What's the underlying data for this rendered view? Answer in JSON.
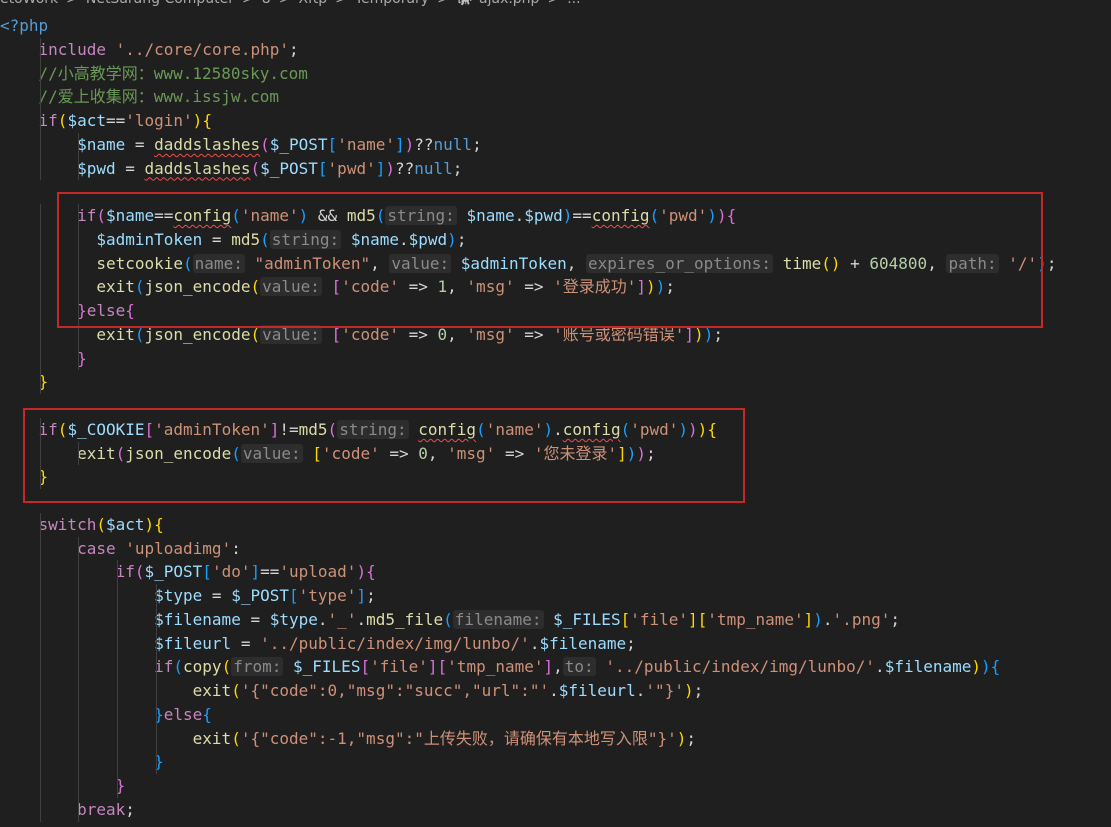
{
  "breadcrumb": {
    "items": [
      "etoWork",
      "NetSarang Computer",
      "8",
      "Xftp",
      "Temporary",
      "ajax.php",
      "..."
    ],
    "separator": ">",
    "file_icon": "php-elephant-icon"
  },
  "editor": {
    "language": "php",
    "lines": [
      [
        {
          "t": "<?php",
          "c": "const"
        }
      ],
      [
        {
          "t": "    "
        },
        {
          "t": "include",
          "c": "keyword"
        },
        {
          "t": " "
        },
        {
          "t": "'../core/core.php'",
          "c": "string"
        },
        {
          "t": ";"
        }
      ],
      [
        {
          "t": "    "
        },
        {
          "t": "//小高教学网：www.12580sky.com",
          "c": "comment"
        }
      ],
      [
        {
          "t": "    "
        },
        {
          "t": "//爱上收集网：www.issjw.com",
          "c": "comment"
        }
      ],
      [
        {
          "t": "    "
        },
        {
          "t": "if",
          "c": "keyword"
        },
        {
          "t": "(",
          "c": "bracket1"
        },
        {
          "t": "$act",
          "c": "var"
        },
        {
          "t": "=="
        },
        {
          "t": "'login'",
          "c": "string"
        },
        {
          "t": ")",
          "c": "bracket1"
        },
        {
          "t": "{",
          "c": "bracket1"
        }
      ],
      [
        {
          "t": "        "
        },
        {
          "t": "$name",
          "c": "var"
        },
        {
          "t": " = "
        },
        {
          "t": "daddslashes",
          "c": "func",
          "sq": true
        },
        {
          "t": "(",
          "c": "bracket2"
        },
        {
          "t": "$_POST",
          "c": "var"
        },
        {
          "t": "[",
          "c": "bracket3"
        },
        {
          "t": "'name'",
          "c": "string"
        },
        {
          "t": "]",
          "c": "bracket3"
        },
        {
          "t": ")",
          "c": "bracket2"
        },
        {
          "t": "??"
        },
        {
          "t": "null",
          "c": "const"
        },
        {
          "t": ";"
        }
      ],
      [
        {
          "t": "        "
        },
        {
          "t": "$pwd",
          "c": "var"
        },
        {
          "t": " = "
        },
        {
          "t": "daddslashes",
          "c": "func",
          "sq": true
        },
        {
          "t": "(",
          "c": "bracket2"
        },
        {
          "t": "$_POST",
          "c": "var"
        },
        {
          "t": "[",
          "c": "bracket3"
        },
        {
          "t": "'pwd'",
          "c": "string"
        },
        {
          "t": "]",
          "c": "bracket3"
        },
        {
          "t": ")",
          "c": "bracket2"
        },
        {
          "t": "??"
        },
        {
          "t": "null",
          "c": "const"
        },
        {
          "t": ";"
        }
      ],
      [],
      [
        {
          "t": "        "
        },
        {
          "t": "if",
          "c": "keyword"
        },
        {
          "t": "(",
          "c": "bracket2"
        },
        {
          "t": "$name",
          "c": "var"
        },
        {
          "t": "=="
        },
        {
          "t": "config",
          "c": "func",
          "sq": true
        },
        {
          "t": "(",
          "c": "bracket3"
        },
        {
          "t": "'name'",
          "c": "string"
        },
        {
          "t": ")",
          "c": "bracket3"
        },
        {
          "t": " && "
        },
        {
          "t": "md5",
          "c": "func"
        },
        {
          "t": "(",
          "c": "bracket3"
        },
        {
          "t": "string:",
          "c": "hint"
        },
        {
          "t": " "
        },
        {
          "t": "$name",
          "c": "var"
        },
        {
          "t": "."
        },
        {
          "t": "$pwd",
          "c": "var"
        },
        {
          "t": ")",
          "c": "bracket3"
        },
        {
          "t": "=="
        },
        {
          "t": "config",
          "c": "func",
          "sq": true
        },
        {
          "t": "(",
          "c": "bracket3"
        },
        {
          "t": "'pwd'",
          "c": "string"
        },
        {
          "t": ")",
          "c": "bracket3"
        },
        {
          "t": ")",
          "c": "bracket2"
        },
        {
          "t": "{",
          "c": "bracket2"
        }
      ],
      [
        {
          "t": "          "
        },
        {
          "t": "$adminToken",
          "c": "var"
        },
        {
          "t": " = "
        },
        {
          "t": "md5",
          "c": "func"
        },
        {
          "t": "(",
          "c": "bracket3"
        },
        {
          "t": "string:",
          "c": "hint"
        },
        {
          "t": " "
        },
        {
          "t": "$name",
          "c": "var"
        },
        {
          "t": "."
        },
        {
          "t": "$pwd",
          "c": "var"
        },
        {
          "t": ")",
          "c": "bracket3"
        },
        {
          "t": ";"
        }
      ],
      [
        {
          "t": "          "
        },
        {
          "t": "setcookie",
          "c": "func"
        },
        {
          "t": "(",
          "c": "bracket3"
        },
        {
          "t": "name:",
          "c": "hint"
        },
        {
          "t": " "
        },
        {
          "t": "\"adminToken\"",
          "c": "string"
        },
        {
          "t": ", "
        },
        {
          "t": "value:",
          "c": "hint"
        },
        {
          "t": " "
        },
        {
          "t": "$adminToken",
          "c": "var"
        },
        {
          "t": ", "
        },
        {
          "t": "expires_or_options:",
          "c": "hint"
        },
        {
          "t": " "
        },
        {
          "t": "time",
          "c": "func"
        },
        {
          "t": "()",
          "c": "bracket1"
        },
        {
          "t": " + "
        },
        {
          "t": "604800",
          "c": "number"
        },
        {
          "t": ", "
        },
        {
          "t": "path:",
          "c": "hint"
        },
        {
          "t": " "
        },
        {
          "t": "'/'",
          "c": "string"
        },
        {
          "t": ")",
          "c": "bracket3"
        },
        {
          "t": ";"
        }
      ],
      [
        {
          "t": "          "
        },
        {
          "t": "exit",
          "c": "func"
        },
        {
          "t": "(",
          "c": "bracket3"
        },
        {
          "t": "json_encode",
          "c": "func"
        },
        {
          "t": "(",
          "c": "bracket1"
        },
        {
          "t": "value:",
          "c": "hint"
        },
        {
          "t": " "
        },
        {
          "t": "[",
          "c": "bracket2"
        },
        {
          "t": "'code'",
          "c": "string"
        },
        {
          "t": " => "
        },
        {
          "t": "1",
          "c": "number"
        },
        {
          "t": ", "
        },
        {
          "t": "'msg'",
          "c": "string"
        },
        {
          "t": " => "
        },
        {
          "t": "'登录成功'",
          "c": "string"
        },
        {
          "t": "]",
          "c": "bracket2"
        },
        {
          "t": ")",
          "c": "bracket1"
        },
        {
          "t": ")",
          "c": "bracket3"
        },
        {
          "t": ";"
        }
      ],
      [
        {
          "t": "        "
        },
        {
          "t": "}",
          "c": "bracket2"
        },
        {
          "t": "else",
          "c": "keyword"
        },
        {
          "t": "{",
          "c": "bracket2"
        }
      ],
      [
        {
          "t": "          "
        },
        {
          "t": "exit",
          "c": "func"
        },
        {
          "t": "(",
          "c": "bracket3"
        },
        {
          "t": "json_encode",
          "c": "func"
        },
        {
          "t": "(",
          "c": "bracket1"
        },
        {
          "t": "value:",
          "c": "hint"
        },
        {
          "t": " "
        },
        {
          "t": "[",
          "c": "bracket2"
        },
        {
          "t": "'code'",
          "c": "string"
        },
        {
          "t": " => "
        },
        {
          "t": "0",
          "c": "number"
        },
        {
          "t": ", "
        },
        {
          "t": "'msg'",
          "c": "string"
        },
        {
          "t": " => "
        },
        {
          "t": "'账号或密码错误'",
          "c": "string"
        },
        {
          "t": "]",
          "c": "bracket2"
        },
        {
          "t": ")",
          "c": "bracket1"
        },
        {
          "t": ")",
          "c": "bracket3"
        },
        {
          "t": ";"
        }
      ],
      [
        {
          "t": "        "
        },
        {
          "t": "}",
          "c": "bracket2"
        }
      ],
      [
        {
          "t": "    "
        },
        {
          "t": "}",
          "c": "bracket1"
        }
      ],
      [],
      [
        {
          "t": "    "
        },
        {
          "t": "if",
          "c": "keyword"
        },
        {
          "t": "(",
          "c": "bracket1"
        },
        {
          "t": "$_COOKIE",
          "c": "var"
        },
        {
          "t": "[",
          "c": "bracket2"
        },
        {
          "t": "'adminToken'",
          "c": "string"
        },
        {
          "t": "]",
          "c": "bracket2"
        },
        {
          "t": "!="
        },
        {
          "t": "md5",
          "c": "func"
        },
        {
          "t": "(",
          "c": "bracket2"
        },
        {
          "t": "string:",
          "c": "hint"
        },
        {
          "t": " "
        },
        {
          "t": "config",
          "c": "func",
          "sq": true
        },
        {
          "t": "(",
          "c": "bracket3"
        },
        {
          "t": "'name'",
          "c": "string"
        },
        {
          "t": ")",
          "c": "bracket3"
        },
        {
          "t": "."
        },
        {
          "t": "config",
          "c": "func",
          "sq": true
        },
        {
          "t": "(",
          "c": "bracket3"
        },
        {
          "t": "'pwd'",
          "c": "string"
        },
        {
          "t": ")",
          "c": "bracket3"
        },
        {
          "t": ")",
          "c": "bracket2"
        },
        {
          "t": ")",
          "c": "bracket1"
        },
        {
          "t": "{",
          "c": "bracket1"
        }
      ],
      [
        {
          "t": "        "
        },
        {
          "t": "exit",
          "c": "func"
        },
        {
          "t": "(",
          "c": "bracket2"
        },
        {
          "t": "json_encode",
          "c": "func"
        },
        {
          "t": "(",
          "c": "bracket3"
        },
        {
          "t": "value:",
          "c": "hint"
        },
        {
          "t": " "
        },
        {
          "t": "[",
          "c": "bracket1"
        },
        {
          "t": "'code'",
          "c": "string"
        },
        {
          "t": " => "
        },
        {
          "t": "0",
          "c": "number"
        },
        {
          "t": ", "
        },
        {
          "t": "'msg'",
          "c": "string"
        },
        {
          "t": " => "
        },
        {
          "t": "'您未登录'",
          "c": "string"
        },
        {
          "t": "]",
          "c": "bracket1"
        },
        {
          "t": ")",
          "c": "bracket3"
        },
        {
          "t": ")",
          "c": "bracket2"
        },
        {
          "t": ";"
        }
      ],
      [
        {
          "t": "    "
        },
        {
          "t": "}",
          "c": "bracket1"
        }
      ],
      [],
      [
        {
          "t": "    "
        },
        {
          "t": "switch",
          "c": "keyword"
        },
        {
          "t": "(",
          "c": "bracket1"
        },
        {
          "t": "$act",
          "c": "var"
        },
        {
          "t": ")",
          "c": "bracket1"
        },
        {
          "t": "{",
          "c": "bracket1"
        }
      ],
      [
        {
          "t": "        "
        },
        {
          "t": "case",
          "c": "keyword"
        },
        {
          "t": " "
        },
        {
          "t": "'uploadimg'",
          "c": "string"
        },
        {
          "t": ":"
        }
      ],
      [
        {
          "t": "            "
        },
        {
          "t": "if",
          "c": "keyword"
        },
        {
          "t": "(",
          "c": "bracket2"
        },
        {
          "t": "$_POST",
          "c": "var"
        },
        {
          "t": "[",
          "c": "bracket3"
        },
        {
          "t": "'do'",
          "c": "string"
        },
        {
          "t": "]",
          "c": "bracket3"
        },
        {
          "t": "=="
        },
        {
          "t": "'upload'",
          "c": "string"
        },
        {
          "t": ")",
          "c": "bracket2"
        },
        {
          "t": "{",
          "c": "bracket2"
        }
      ],
      [
        {
          "t": "                "
        },
        {
          "t": "$type",
          "c": "var"
        },
        {
          "t": " = "
        },
        {
          "t": "$_POST",
          "c": "var"
        },
        {
          "t": "[",
          "c": "bracket3"
        },
        {
          "t": "'type'",
          "c": "string"
        },
        {
          "t": "]",
          "c": "bracket3"
        },
        {
          "t": ";"
        }
      ],
      [
        {
          "t": "                "
        },
        {
          "t": "$filename",
          "c": "var"
        },
        {
          "t": " = "
        },
        {
          "t": "$type",
          "c": "var"
        },
        {
          "t": "."
        },
        {
          "t": "'_'",
          "c": "string"
        },
        {
          "t": "."
        },
        {
          "t": "md5_file",
          "c": "func"
        },
        {
          "t": "(",
          "c": "bracket3"
        },
        {
          "t": "filename:",
          "c": "hint"
        },
        {
          "t": " "
        },
        {
          "t": "$_FILES",
          "c": "var"
        },
        {
          "t": "[",
          "c": "bracket1"
        },
        {
          "t": "'file'",
          "c": "string"
        },
        {
          "t": "]",
          "c": "bracket1"
        },
        {
          "t": "[",
          "c": "bracket1"
        },
        {
          "t": "'tmp_name'",
          "c": "string"
        },
        {
          "t": "]",
          "c": "bracket1"
        },
        {
          "t": ")",
          "c": "bracket3"
        },
        {
          "t": "."
        },
        {
          "t": "'.png'",
          "c": "string"
        },
        {
          "t": ";"
        }
      ],
      [
        {
          "t": "                "
        },
        {
          "t": "$fileurl",
          "c": "var"
        },
        {
          "t": " = "
        },
        {
          "t": "'../public/index/img/lunbo/'",
          "c": "string"
        },
        {
          "t": "."
        },
        {
          "t": "$filename",
          "c": "var"
        },
        {
          "t": ";"
        }
      ],
      [
        {
          "t": "                "
        },
        {
          "t": "if",
          "c": "keyword"
        },
        {
          "t": "(",
          "c": "bracket3"
        },
        {
          "t": "copy",
          "c": "func"
        },
        {
          "t": "(",
          "c": "bracket1"
        },
        {
          "t": "from:",
          "c": "hint"
        },
        {
          "t": " "
        },
        {
          "t": "$_FILES",
          "c": "var"
        },
        {
          "t": "[",
          "c": "bracket2"
        },
        {
          "t": "'file'",
          "c": "string"
        },
        {
          "t": "]",
          "c": "bracket2"
        },
        {
          "t": "[",
          "c": "bracket2"
        },
        {
          "t": "'tmp_name'",
          "c": "string"
        },
        {
          "t": "]",
          "c": "bracket2"
        },
        {
          "t": ","
        },
        {
          "t": "to:",
          "c": "hint"
        },
        {
          "t": " "
        },
        {
          "t": "'../public/index/img/lunbo/'",
          "c": "string"
        },
        {
          "t": "."
        },
        {
          "t": "$filename",
          "c": "var"
        },
        {
          "t": ")",
          "c": "bracket1"
        },
        {
          "t": ")",
          "c": "bracket3"
        },
        {
          "t": "{",
          "c": "bracket3"
        }
      ],
      [
        {
          "t": "                    "
        },
        {
          "t": "exit",
          "c": "func"
        },
        {
          "t": "(",
          "c": "bracket1"
        },
        {
          "t": "'{\"code\":0,\"msg\":\"succ\",\"url\":\"'",
          "c": "string"
        },
        {
          "t": "."
        },
        {
          "t": "$fileurl",
          "c": "var"
        },
        {
          "t": "."
        },
        {
          "t": "'\"}'",
          "c": "string"
        },
        {
          "t": ")",
          "c": "bracket1"
        },
        {
          "t": ";"
        }
      ],
      [
        {
          "t": "                "
        },
        {
          "t": "}",
          "c": "bracket3"
        },
        {
          "t": "else",
          "c": "keyword"
        },
        {
          "t": "{",
          "c": "bracket3"
        }
      ],
      [
        {
          "t": "                    "
        },
        {
          "t": "exit",
          "c": "func"
        },
        {
          "t": "(",
          "c": "bracket1"
        },
        {
          "t": "'{\"code\":-1,\"msg\":\"上传失败，请确保有本地写入限\"}'",
          "c": "string"
        },
        {
          "t": ")",
          "c": "bracket1"
        },
        {
          "t": ";"
        }
      ],
      [
        {
          "t": "                "
        },
        {
          "t": "}",
          "c": "bracket3"
        }
      ],
      [
        {
          "t": "            "
        },
        {
          "t": "}",
          "c": "bracket2"
        }
      ],
      [
        {
          "t": "        "
        },
        {
          "t": "break",
          "c": "keyword"
        },
        {
          "t": ";"
        }
      ]
    ]
  },
  "annotations": {
    "box_color": "#c62828",
    "boxes": [
      "login-check-block",
      "cookie-check-block"
    ]
  }
}
